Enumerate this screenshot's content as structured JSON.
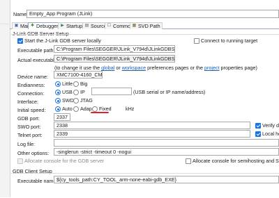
{
  "config_name": {
    "label": "Name:",
    "value": "Empty_App Program (JLink)"
  },
  "tabs": [
    {
      "label": "Main",
      "icon": "main-tab-icon",
      "glyph": "▣"
    },
    {
      "label": "Debugger",
      "icon": "debugger-tab-icon",
      "glyph": "✱"
    },
    {
      "label": "Startup",
      "icon": "startup-tab-icon",
      "glyph": "▶"
    },
    {
      "label": "Source",
      "icon": "source-tab-icon",
      "glyph": "▤"
    },
    {
      "label": "Common",
      "icon": "common-tab-icon",
      "glyph": "☐"
    },
    {
      "label": "SVD Path",
      "icon": "svd-tab-icon",
      "glyph": "▦"
    }
  ],
  "server": {
    "group_title": "J-Link GDB Server Setup",
    "start_locally_label": "Start the J-Link GDB server locally",
    "start_locally_checked": true,
    "connect_running_label": "Connect to running target",
    "connect_running_checked": false,
    "exec_path_label": "Executable path:",
    "exec_path_value": "C:\\Program Files\\SEGGER\\JLink_V794d\\JLinkGDBServerCL.exe",
    "actual_exec_label": "Actual executable:",
    "actual_exec_value": "C:\\Program Files\\SEGGER\\JLink_V794d\\JLinkGDBServerCL.exe",
    "note_prefix": "(to change it use the ",
    "note_link1": "global",
    "note_mid1": " or ",
    "note_link2": "workspace",
    "note_mid2": " preferences pages or the ",
    "note_link3": "project",
    "note_suffix": " properties page)",
    "device_label": "Device name:",
    "device_value": "XMC7100-4160_CM7_0",
    "endianness_label": "Endianness:",
    "endianness_options": [
      "Little",
      "Big"
    ],
    "endianness_selected": "Little",
    "connection_label": "Connection:",
    "connection_options": [
      "USB",
      "IP"
    ],
    "connection_selected": "USB",
    "connection_hint": "(USB serial or IP name/address)",
    "interface_label": "Interface:",
    "interface_options": [
      "SWD",
      "JTAG"
    ],
    "interface_selected": "SWD",
    "speed_label": "Initial speed:",
    "speed_options": [
      "Auto",
      "Adap",
      "Fixed"
    ],
    "speed_selected": "Auto",
    "speed_unit": "kHz",
    "gdb_port_label": "GDB port:",
    "gdb_port_value": "2337",
    "swo_port_label": "SWO port:",
    "swo_port_value": "2338",
    "verify_label": "Verify do",
    "verify_checked": true,
    "telnet_label": "Telnet port:",
    "telnet_value": "2339",
    "local_host_label": "Local hos",
    "local_host_checked": true,
    "log_file_label": "Log file:",
    "log_file_value": "",
    "other_options_label": "Other options:",
    "other_options_value": "-singlerun -strict -timeout 0 -nogui",
    "alloc_gdb_label": "Allocate console for the GDB server",
    "alloc_semi_label": "Allocate console for semihosting and SWO"
  },
  "client": {
    "group_title": "GDB Client Setup",
    "exec_name_label": "Executable name:",
    "exec_name_value": "${cy_tools_path:CY_TOOL_arm-none-eabi-gdb_EXE}"
  },
  "colors": {
    "accent": "#1a73e8",
    "link": "#1a5fb4",
    "annotation": "#e0202a"
  }
}
